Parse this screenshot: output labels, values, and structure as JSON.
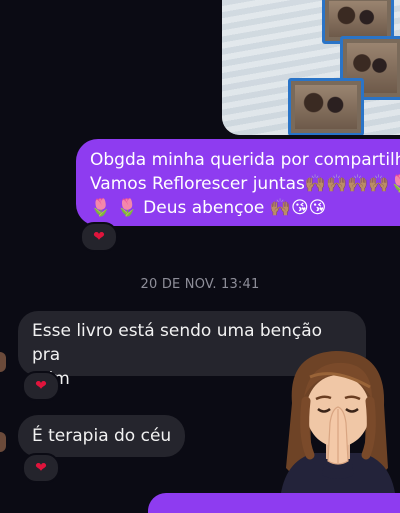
{
  "shared_image": {
    "icon": "shared-photo-image"
  },
  "messages": {
    "outgoing_1": {
      "line1": "Obgda minha querida por compartilha",
      "line2": "Vamos Reflorescer juntas🙌🏽🙌🏽🙌🏽🙌🏽🌷",
      "line3": "🌷 🌷 Deus abençoe 🙌🏽😘😘",
      "reaction": "❤"
    },
    "timestamp": "20 DE NOV. 13:41",
    "incoming_1": {
      "line1": "Esse livro está sendo uma benção pra",
      "line2": "mim",
      "reaction": "❤"
    },
    "incoming_2": {
      "text": "É terapia do céu",
      "reaction": "❤"
    }
  },
  "sticker": {
    "icon": "praying-memoji-sticker"
  },
  "colors": {
    "background": "#0b0b14",
    "outgoing_bubble": "#8e3cf0",
    "incoming_bubble": "#25252d",
    "heart": "#e0143c",
    "timestamp": "#8e8e99"
  }
}
